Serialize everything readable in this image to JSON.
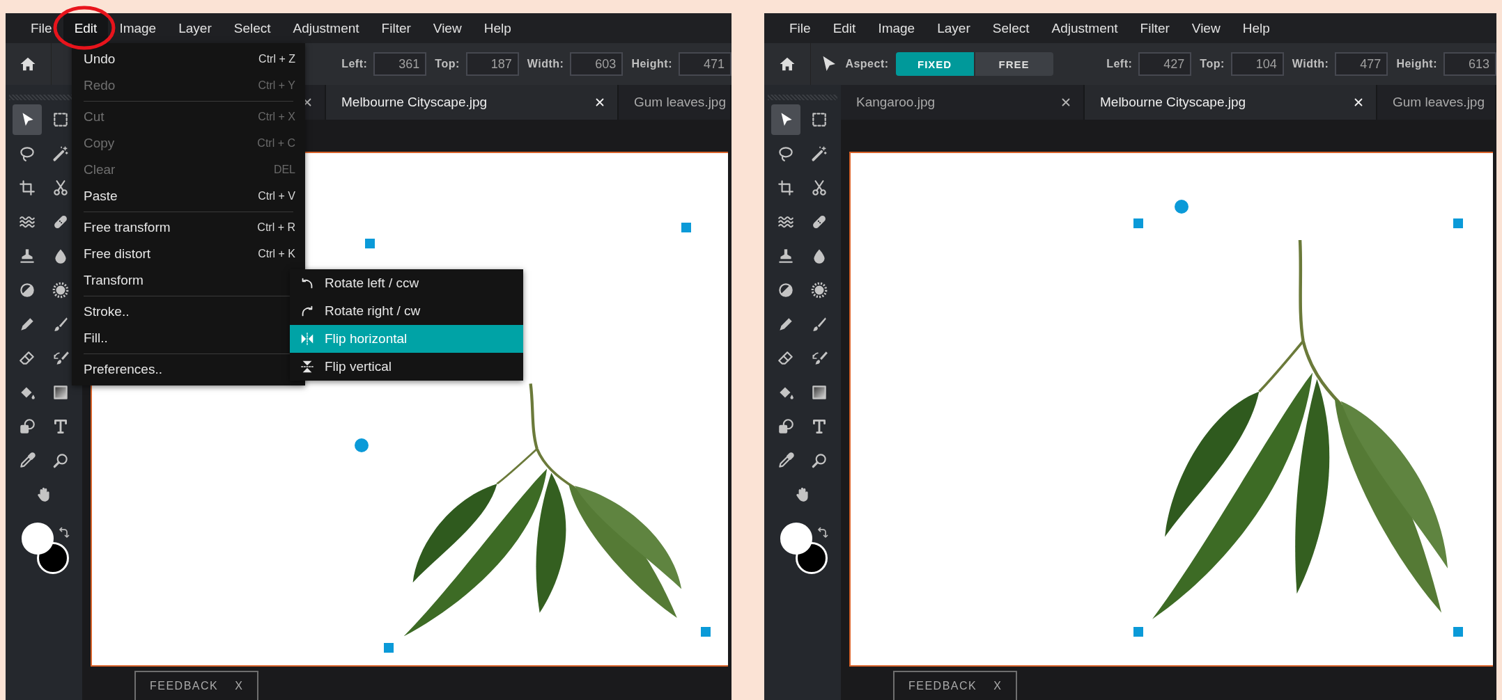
{
  "panels": [
    {
      "menubar": [
        {
          "label": "File",
          "selected": false
        },
        {
          "label": "Edit",
          "selected": true
        },
        {
          "label": "Image",
          "selected": false
        },
        {
          "label": "Layer",
          "selected": false
        },
        {
          "label": "Select",
          "selected": false
        },
        {
          "label": "Adjustment",
          "selected": false
        },
        {
          "label": "Filter",
          "selected": false
        },
        {
          "label": "View",
          "selected": false
        },
        {
          "label": "Help",
          "selected": false
        }
      ],
      "open_menu": {
        "items": [
          {
            "kind": "item",
            "label": "Undo",
            "shortcut": "Ctrl + Z",
            "disabled": false
          },
          {
            "kind": "item",
            "label": "Redo",
            "shortcut": "Ctrl + Y",
            "disabled": true
          },
          {
            "kind": "separator"
          },
          {
            "kind": "item",
            "label": "Cut",
            "shortcut": "Ctrl + X",
            "disabled": true
          },
          {
            "kind": "item",
            "label": "Copy",
            "shortcut": "Ctrl + C",
            "disabled": true
          },
          {
            "kind": "item",
            "label": "Clear",
            "shortcut": "DEL",
            "disabled": true
          },
          {
            "kind": "item",
            "label": "Paste",
            "shortcut": "Ctrl + V",
            "disabled": false
          },
          {
            "kind": "separator"
          },
          {
            "kind": "item",
            "label": "Free transform",
            "shortcut": "Ctrl + R",
            "disabled": false
          },
          {
            "kind": "item",
            "label": "Free distort",
            "shortcut": "Ctrl + K",
            "disabled": false
          },
          {
            "kind": "item",
            "label": "Transform",
            "disabled": false
          },
          {
            "kind": "separator"
          },
          {
            "kind": "item",
            "label": "Stroke..",
            "disabled": false
          },
          {
            "kind": "item",
            "label": "Fill..",
            "disabled": false
          },
          {
            "kind": "separator"
          },
          {
            "kind": "item",
            "label": "Preferences..",
            "disabled": false
          }
        ],
        "submenu": [
          {
            "label": "Rotate left / ccw",
            "selected": false
          },
          {
            "label": "Rotate right / cw",
            "selected": false
          },
          {
            "label": "Flip horizontal",
            "selected": true
          },
          {
            "label": "Flip vertical",
            "selected": false
          }
        ]
      },
      "toolbar": {
        "fields": [
          {
            "label": "Left:",
            "value": "361"
          },
          {
            "label": "Top:",
            "value": "187"
          },
          {
            "label": "Width:",
            "value": "603"
          },
          {
            "label": "Height:",
            "value": "471"
          }
        ]
      },
      "tabs": [
        {
          "selected": false,
          "closable": true
        },
        {
          "label": "Melbourne Cityscape.jpg",
          "selected": true,
          "closable": true
        },
        {
          "label": "Gum leaves.jpg",
          "selected": false,
          "closable": false
        }
      ],
      "tools": [
        {
          "selected": true
        },
        {
          "selected": false
        },
        {
          "selected": false
        },
        {
          "selected": false
        },
        {
          "selected": false
        },
        {
          "selected": false
        },
        {
          "selected": false
        },
        {
          "selected": false
        },
        {
          "selected": false
        },
        {
          "selected": false
        },
        {
          "selected": false
        },
        {
          "selected": false
        },
        {
          "selected": false
        },
        {
          "selected": false
        },
        {
          "selected": false
        },
        {
          "selected": false
        },
        {
          "selected": false
        },
        {
          "selected": false
        },
        {
          "selected": false
        },
        {
          "selected": false
        },
        {
          "selected": false
        },
        {
          "selected": false
        },
        {
          "selected": false
        }
      ],
      "swatches": [
        {
          "color": "#ffffff"
        },
        {
          "color": "#000000"
        }
      ],
      "feedback": {
        "label": "FEEDBACK",
        "close": "X"
      }
    },
    {
      "menubar": [
        {
          "label": "File",
          "selected": false
        },
        {
          "label": "Edit",
          "selected": false
        },
        {
          "label": "Image",
          "selected": false
        },
        {
          "label": "Layer",
          "selected": false
        },
        {
          "label": "Select",
          "selected": false
        },
        {
          "label": "Adjustment",
          "selected": false
        },
        {
          "label": "Filter",
          "selected": false
        },
        {
          "label": "View",
          "selected": false
        },
        {
          "label": "Help",
          "selected": false
        }
      ],
      "toolbar": {
        "aspect_label": "Aspect:",
        "aspect_options": [
          {
            "label": "FIXED",
            "selected": true
          },
          {
            "label": "FREE",
            "selected": false
          }
        ],
        "fields": [
          {
            "label": "Left:",
            "value": "427"
          },
          {
            "label": "Top:",
            "value": "104"
          },
          {
            "label": "Width:",
            "value": "477"
          },
          {
            "label": "Height:",
            "value": "613"
          }
        ]
      },
      "tabs": [
        {
          "label": "Kangaroo.jpg",
          "selected": false,
          "closable": true
        },
        {
          "label": "Melbourne Cityscape.jpg",
          "selected": true,
          "closable": true
        },
        {
          "label": "Gum leaves.jpg",
          "selected": false,
          "closable": false
        }
      ],
      "tools": [
        {
          "selected": true
        },
        {
          "selected": false
        },
        {
          "selected": false
        },
        {
          "selected": false
        },
        {
          "selected": false
        },
        {
          "selected": false
        },
        {
          "selected": false
        },
        {
          "selected": false
        },
        {
          "selected": false
        },
        {
          "selected": false
        },
        {
          "selected": false
        },
        {
          "selected": false
        },
        {
          "selected": false
        },
        {
          "selected": false
        },
        {
          "selected": false
        },
        {
          "selected": false
        },
        {
          "selected": false
        },
        {
          "selected": false
        },
        {
          "selected": false
        },
        {
          "selected": false
        },
        {
          "selected": false
        },
        {
          "selected": false
        },
        {
          "selected": false
        }
      ],
      "swatches": [
        {
          "color": "#ffffff"
        },
        {
          "color": "#000000"
        }
      ],
      "feedback": {
        "label": "FEEDBACK",
        "close": "X"
      }
    }
  ]
}
